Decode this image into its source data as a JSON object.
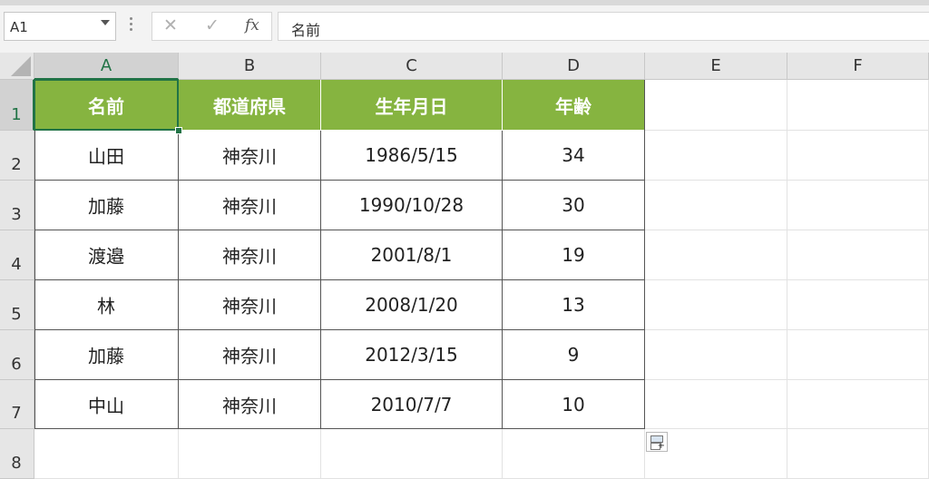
{
  "name_box": {
    "value": "A1"
  },
  "formula_bar": {
    "cancel_symbol": "✕",
    "enter_symbol": "✓",
    "fx_label": "fx",
    "value": "名前"
  },
  "columns": [
    "A",
    "B",
    "C",
    "D",
    "E",
    "F"
  ],
  "rows": [
    "1",
    "2",
    "3",
    "4",
    "5",
    "6",
    "7",
    "8"
  ],
  "table": {
    "header": [
      "名前",
      "都道府県",
      "生年月日",
      "年齢"
    ],
    "rows": [
      [
        "山田",
        "神奈川",
        "1986/5/15",
        "34"
      ],
      [
        "加藤",
        "神奈川",
        "1990/10/28",
        "30"
      ],
      [
        "渡邉",
        "神奈川",
        "2001/8/1",
        "19"
      ],
      [
        "林",
        "神奈川",
        "2008/1/20",
        "13"
      ],
      [
        "加藤",
        "神奈川",
        "2012/3/15",
        "9"
      ],
      [
        "中山",
        "神奈川",
        "2010/7/7",
        "10"
      ]
    ]
  },
  "colors": {
    "header_fill": "#86b440",
    "selection": "#217346"
  },
  "icons": {
    "paste_options": "paste-options-icon"
  }
}
